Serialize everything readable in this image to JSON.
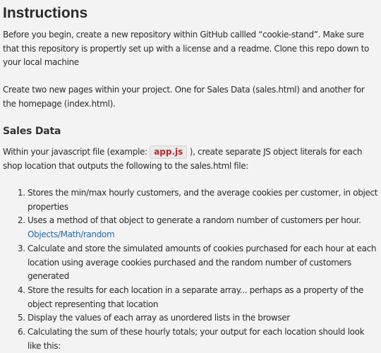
{
  "title": "Instructions",
  "para1": "Before you begin, create a new repository within GitHub callled “cookie-stand”. Make sure that this repository is propertly set up with a license and a readme. Clone this repo down to your local machine",
  "para2": "Create two new pages within your project. One for Sales Data (sales.html) and another for the homepage (index.html).",
  "section_heading": "Sales Data",
  "para3": {
    "before": "Within your javascript file (example: ",
    "code": "app.js",
    "after": " ), create separate JS object literals for each shop location that outputs the following to the sales.html file:"
  },
  "steps": [
    {
      "num": "1.",
      "text": "Stores the min/max hourly customers, and the average cookies per customer, in object properties"
    },
    {
      "num": "2.",
      "text": "Uses a method of that object to generate a random number of customers per hour.",
      "link": "Objects/Math/random"
    },
    {
      "num": "3.",
      "text": "Calculate and store the simulated amounts of cookies purchased for each hour at each location using average cookies purchased and the random number of customers generated"
    },
    {
      "num": "4.",
      "text": "Store the results for each location in a separate array... perhaps as a property of the object representing that location"
    },
    {
      "num": "5.",
      "text": "Display the values of each array as unordered lists in the browser"
    },
    {
      "num": "6.",
      "text": "Calculating the sum of these hourly totals; your output for each location should look like this:"
    }
  ]
}
